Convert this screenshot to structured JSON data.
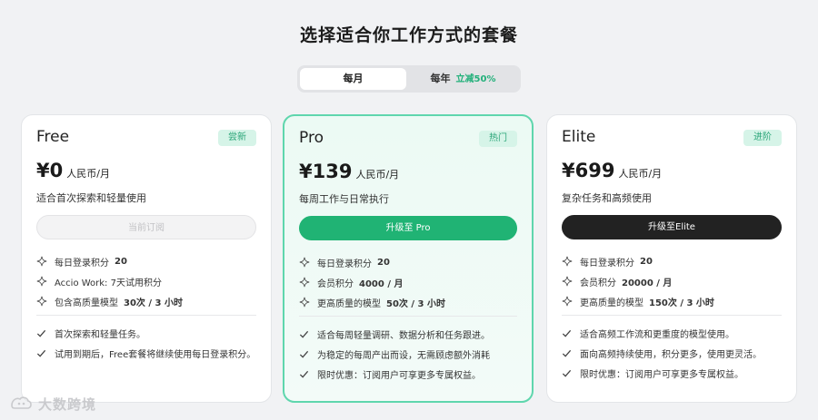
{
  "page": {
    "title": "选择适合你工作方式的套餐"
  },
  "billing_toggle": {
    "monthly_label": "每月",
    "yearly_label": "每年",
    "yearly_discount": "立减50%",
    "selected": "monthly"
  },
  "plans": [
    {
      "name": "Free",
      "badge": "尝新",
      "price": "¥0",
      "unit": "人民币/月",
      "description": "适合首次探索和轻量使用",
      "button_label": "当前订阅",
      "button_style": "disabled",
      "features": [
        {
          "label": "每日登录积分",
          "value": "20"
        },
        {
          "label": "Accio Work: 7天试用积分",
          "value": ""
        },
        {
          "label": "包含高质量模型",
          "value": "30次 / 3 小时"
        }
      ],
      "benefits": [
        "首次探索和轻量任务。",
        "试用到期后，Free套餐将继续使用每日登录积分。"
      ]
    },
    {
      "name": "Pro",
      "badge": "热门",
      "price": "¥139",
      "unit": "人民币/月",
      "description": "每周工作与日常执行",
      "button_label": "升级至 Pro",
      "button_style": "green",
      "features": [
        {
          "label": "每日登录积分",
          "value": "20"
        },
        {
          "label": "会员积分",
          "value": "4000 / 月"
        },
        {
          "label": "更高质量的模型",
          "value": "50次 / 3 小时"
        }
      ],
      "benefits": [
        "适合每周轻量调研、数据分析和任务跟进。",
        "为稳定的每周产出而设，无需顾虑额外消耗",
        "限时优惠：订阅用户可享更多专属权益。"
      ]
    },
    {
      "name": "Elite",
      "badge": "进阶",
      "price": "¥699",
      "unit": "人民币/月",
      "description": "复杂任务和高频使用",
      "button_label": "升级至Elite",
      "button_style": "dark",
      "features": [
        {
          "label": "每日登录积分",
          "value": "20"
        },
        {
          "label": "会员积分",
          "value": "20000 / 月"
        },
        {
          "label": "更高质量的模型",
          "value": "150次 / 3 小时"
        }
      ],
      "benefits": [
        "适合高频工作流和更重度的模型使用。",
        "面向高频持续使用，积分更多，使用更灵活。",
        "限时优惠：订阅用户可享更多专属权益。"
      ]
    }
  ],
  "watermark": "大数跨境",
  "icons": {
    "feature": "sparkle-icon",
    "benefit": "checkmark-icon"
  },
  "colors": {
    "accent_green": "#20b374",
    "badge_bg": "#d6f4e8",
    "discount_text": "#22b07a",
    "dark_button": "#222222"
  }
}
